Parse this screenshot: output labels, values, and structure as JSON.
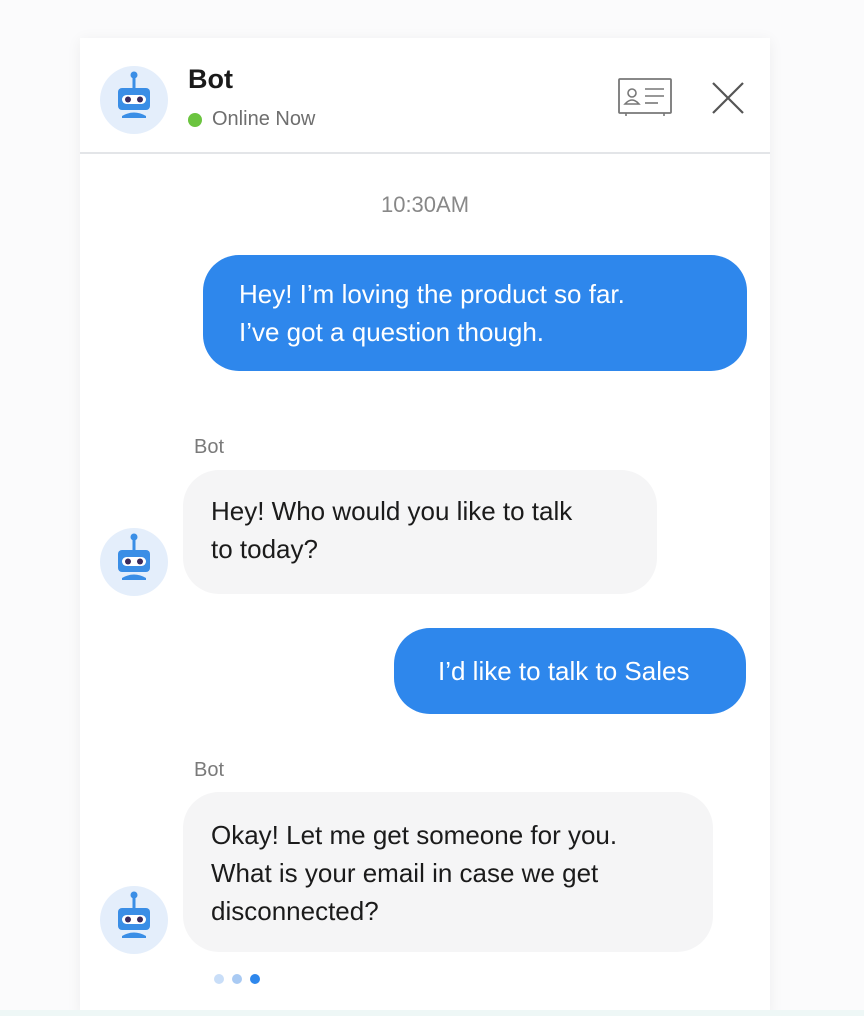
{
  "header": {
    "bot_name": "Bot",
    "status_text": "Online Now",
    "status_color": "#6bc43f",
    "icons": [
      "robot-avatar-icon",
      "contact-card-icon",
      "close-icon"
    ]
  },
  "conversation": {
    "timestamp": "10:30AM",
    "messages": [
      {
        "from": "user",
        "lines": [
          "Hey! I’m loving the product so far.",
          "I’ve got a question though."
        ]
      },
      {
        "from": "bot",
        "sender": "Bot",
        "lines": [
          "Hey! Who would you like to talk",
          "to today?"
        ]
      },
      {
        "from": "user",
        "lines": [
          "I’d like to talk to Sales"
        ]
      },
      {
        "from": "bot",
        "sender": "Bot",
        "lines": [
          "Okay! Let me get someone for you.",
          "What is your email in case we get",
          "disconnected?"
        ]
      }
    ],
    "typing_indicator": {
      "dots": 3,
      "active_dot": 3
    }
  },
  "colors": {
    "accent": "#2e87ec",
    "bot_bubble": "#f5f5f6",
    "avatar_bg": "#e4eefb",
    "robot_body": "#3a8ee6"
  }
}
